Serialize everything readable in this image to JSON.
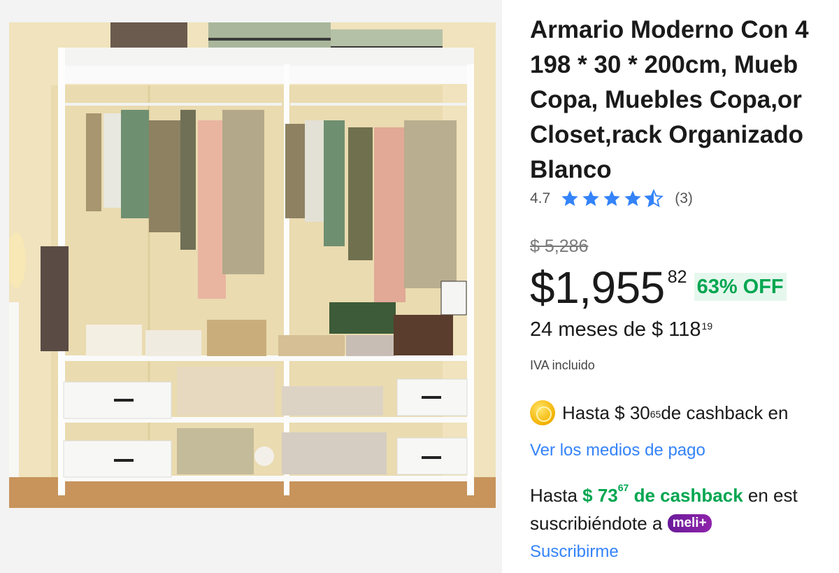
{
  "product": {
    "title_lines": [
      "Armario Moderno Con 4",
      "198 * 30 * 200cm, Mueb",
      "Copa, Muebles Copa,or",
      "Closet,rack Organizado",
      "Blanco"
    ],
    "rating": "4.7",
    "rating_value": 4.7,
    "review_count": "(3)",
    "original_price": "$ 5,286",
    "price_main": "$1,955",
    "price_cents": "82",
    "discount": "63% OFF",
    "installments_text": "24 meses de $ 118",
    "installments_cents": "19",
    "tax_note": "IVA incluido",
    "cashback_prefix": "Hasta $ 30",
    "cashback_cents": "65",
    "cashback_suffix": " de cashback en",
    "payment_methods_link": "Ver los medios de pago",
    "meli_cashback_prefix": "Hasta ",
    "meli_cashback_amount": "$ 73",
    "meli_cashback_cents": "67",
    "meli_cashback_label": " de cashback",
    "meli_cashback_suffix": " en est",
    "subscribe_text": "suscribiéndote a ",
    "meli_badge": "meli+",
    "subscribe_link": "Suscribirme"
  },
  "icons": {
    "star": "star-icon",
    "coin": "coin-icon"
  },
  "colors": {
    "link": "#3483fa",
    "discount_green": "#00a650",
    "star_blue": "#3483fa",
    "meli_purple": "#7b1fa2"
  }
}
